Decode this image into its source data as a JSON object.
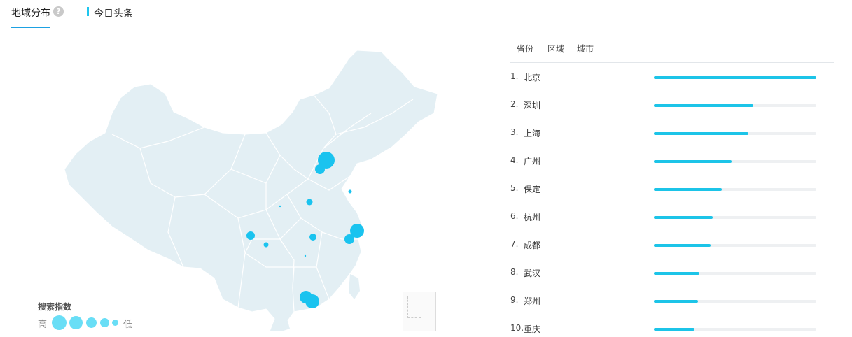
{
  "header": {
    "tab_title": "地域分布",
    "help_icon": "?",
    "source_label": "今日头条",
    "accent_color": "#1da1e2",
    "source_bar_color": "#1ec6ee"
  },
  "map": {
    "bubble_color": "#1ac3ef",
    "land_color": "#e3eff4",
    "border_color": "#ffffff"
  },
  "legend": {
    "title": "搜索指数",
    "high_label": "高",
    "low_label": "低"
  },
  "ranking": {
    "tabs": [
      {
        "label": "省份"
      },
      {
        "label": "区域"
      },
      {
        "label": "城市"
      }
    ],
    "items": [
      {
        "rank": "1.",
        "name": "北京",
        "share": 1.0
      },
      {
        "rank": "2.",
        "name": "深圳",
        "share": 0.61
      },
      {
        "rank": "3.",
        "name": "上海",
        "share": 0.58
      },
      {
        "rank": "4.",
        "name": "广州",
        "share": 0.48
      },
      {
        "rank": "5.",
        "name": "保定",
        "share": 0.42
      },
      {
        "rank": "6.",
        "name": "杭州",
        "share": 0.36
      },
      {
        "rank": "7.",
        "name": "成都",
        "share": 0.35
      },
      {
        "rank": "8.",
        "name": "武汉",
        "share": 0.28
      },
      {
        "rank": "9.",
        "name": "郑州",
        "share": 0.27
      },
      {
        "rank": "10.",
        "name": "重庆",
        "share": 0.25
      }
    ],
    "bar_color": "#1cc4e8",
    "track_color": "#eef0f2"
  }
}
